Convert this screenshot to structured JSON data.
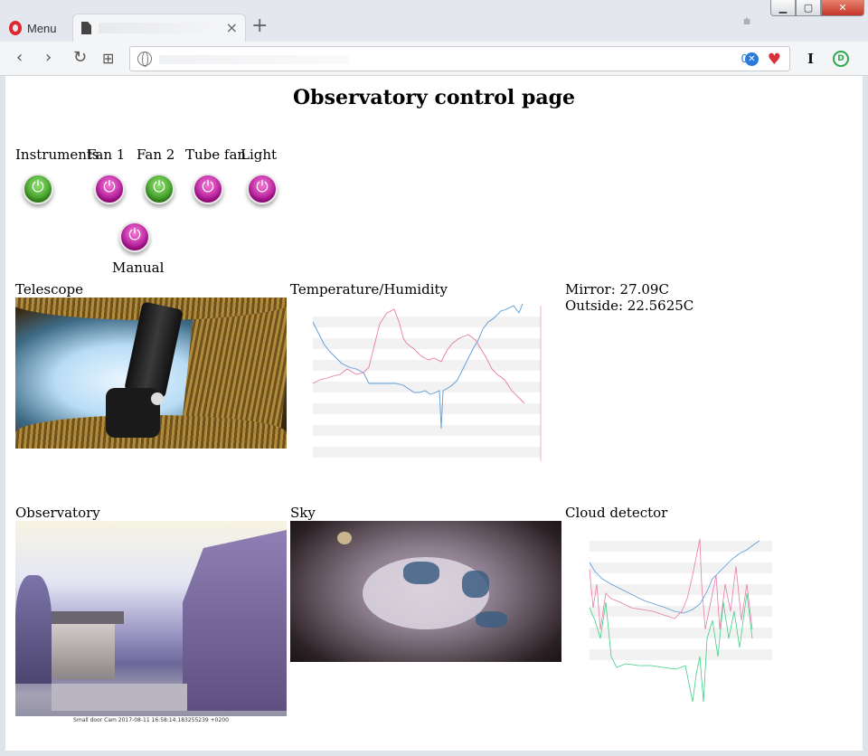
{
  "browser": {
    "menu_label": "Menu",
    "tab_close": "×",
    "new_tab": "+",
    "tab_menu": "⩧",
    "win_min": "▁",
    "win_max": "▢",
    "win_close": "✕",
    "adblock_count": "0",
    "adblock_badge": "✕",
    "heart": "♥",
    "ext_i": "I",
    "ext_d": "D",
    "nav": {
      "back": "‹",
      "forward": "›",
      "reload": "↻",
      "grid": "⊞"
    }
  },
  "page": {
    "title": "Observatory control page",
    "controls": [
      {
        "label": "Instruments",
        "state": "on"
      },
      {
        "label": "Fan 1",
        "state": "off"
      },
      {
        "label": "Fan 2",
        "state": "on"
      },
      {
        "label": "Tube fan",
        "state": "off"
      },
      {
        "label": "Light",
        "state": "off"
      }
    ],
    "manual": {
      "label": "Manual",
      "state": "off"
    },
    "panels": {
      "telescope": "Telescope",
      "temperature": "Temperature/Humidity",
      "observatory": "Observatory",
      "sky": "Sky",
      "cloud": "Cloud detector"
    },
    "readouts": {
      "mirror": "Mirror: 27.09C",
      "outside": "Outside: 22.5625C"
    },
    "captions": {
      "observatory": "Small door Cam 2017-08-11 16:58:14.183255239 +0200"
    },
    "colors": {
      "on": "#3c9a22",
      "off": "#b11296"
    }
  }
}
